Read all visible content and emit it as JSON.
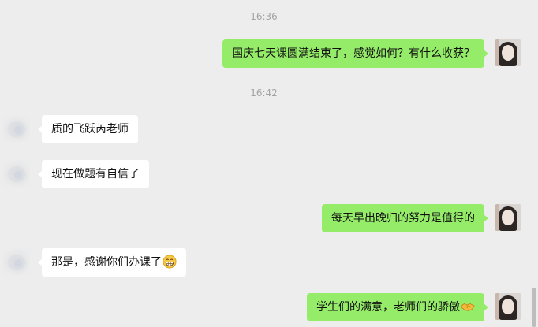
{
  "timestamps": [
    "16:36",
    "16:42"
  ],
  "messages": [
    {
      "sender": "self",
      "text": "国庆七天课圆满结束了，感觉如何？有什么收获？"
    },
    {
      "sender": "other",
      "text": "质的飞跃芮老师"
    },
    {
      "sender": "other",
      "text": "现在做题有自信了"
    },
    {
      "sender": "self",
      "text": "每天早出晚归的努力是值得的"
    },
    {
      "sender": "other",
      "text": "那是，感谢你们办课了",
      "emoji": "grinning-face-icon"
    },
    {
      "sender": "self",
      "text": "学生们的满意，老师们的骄傲",
      "emoji": "handshake-icon"
    }
  ],
  "colors": {
    "background": "#ededed",
    "self_bubble": "#95ec69",
    "other_bubble": "#ffffff",
    "timestamp": "#a4a4a4"
  }
}
